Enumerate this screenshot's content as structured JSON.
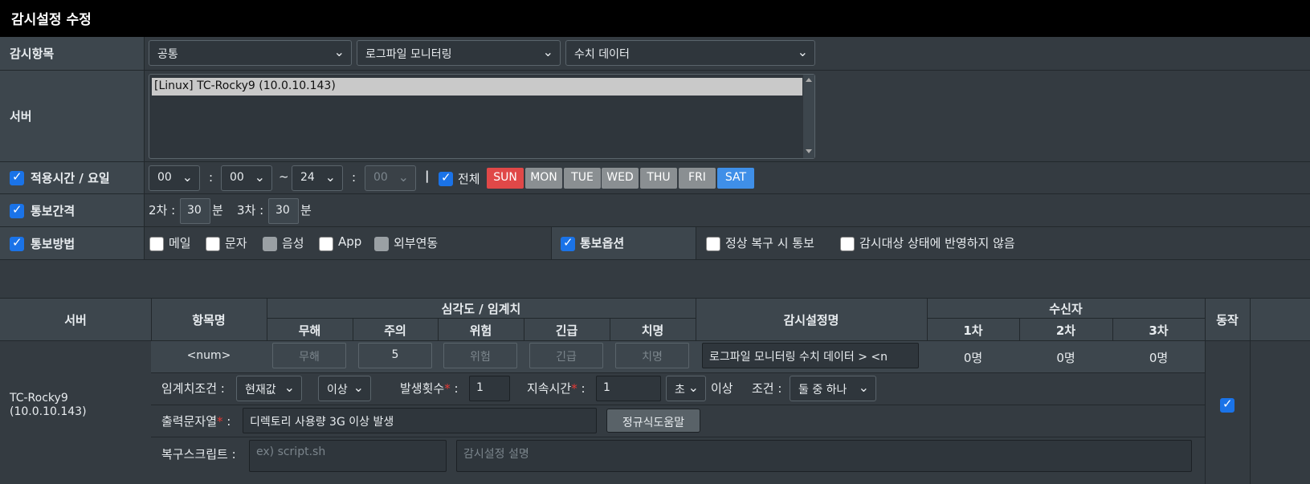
{
  "title": "감시설정 수정",
  "monitor_item": {
    "label": "감시항목",
    "select1": "공통",
    "select2": "로그파일 모니터링",
    "select3": "수치 데이터"
  },
  "server": {
    "label": "서버",
    "selected": "[Linux] TC-Rocky9 (10.0.10.143)"
  },
  "schedule": {
    "label": "적용시간 / 요일",
    "start_hour": "00",
    "start_min": "00",
    "tilde": "~",
    "end_hour": "24",
    "end_min": "00",
    "colon": ":",
    "sep": "|",
    "all_label": "전체",
    "days": [
      {
        "label": "SUN",
        "color": "#e04848"
      },
      {
        "label": "MON",
        "color": "#8a8f92"
      },
      {
        "label": "TUE",
        "color": "#8a8f92"
      },
      {
        "label": "WED",
        "color": "#8a8f92"
      },
      {
        "label": "THU",
        "color": "#8a8f92"
      },
      {
        "label": "FRI",
        "color": "#8a8f92"
      },
      {
        "label": "SAT",
        "color": "#3f8fe8"
      }
    ]
  },
  "interval": {
    "label": "통보간격",
    "second_label": "2차 :",
    "second_value": "30",
    "third_label": "3차 :",
    "third_value": "30",
    "unit": "분"
  },
  "method": {
    "label": "통보방법",
    "options": [
      "메일",
      "문자",
      "음성",
      "App",
      "외부연동"
    ],
    "notify_option_label": "통보옵션",
    "opt1": "정상 복구 시 통보",
    "opt2": "감시대상 상태에 반영하지 않음"
  },
  "table": {
    "col_server": "서버",
    "col_item": "항목명",
    "col_severity": "심각도 / 임계치",
    "sev": [
      "무해",
      "주의",
      "위험",
      "긴급",
      "치명"
    ],
    "col_name": "감시설정명",
    "col_recv": "수신자",
    "recv_cols": [
      "1차",
      "2차",
      "3차"
    ],
    "col_action": "동작",
    "server_name": "TC-Rocky9",
    "server_ip": "(10.0.10.143)",
    "item_name": "<num>",
    "sev_values": [
      "",
      "5",
      "",
      "",
      ""
    ],
    "sev_placeholders": [
      "무해",
      "",
      "위험",
      "긴급",
      "치명"
    ],
    "setting_name": "로그파일 모니터링 수치 데이터 > <n",
    "recv_values": [
      "0명",
      "0명",
      "0명"
    ],
    "threshold_label": "임계치조건 :",
    "threshold_sel": "현재값",
    "cmp_sel": "이상",
    "occur_label": "발생횟수",
    "occur_value": "1",
    "duration_label": "지속시간",
    "duration_value": "1",
    "duration_unit": "초",
    "over_text": "이상",
    "cond_label": "조건 :",
    "cond_sel": "둘 중 하나",
    "output_label": "출력문자열",
    "output_value": "디렉토리 사용량 3G 이상 발생",
    "regex_btn": "정규식도움말",
    "script_label": "복구스크립트 :",
    "script_placeholder": "ex) script.sh",
    "desc_placeholder": "감시설정 설명",
    "asterisk": "*",
    "colon": ":"
  }
}
